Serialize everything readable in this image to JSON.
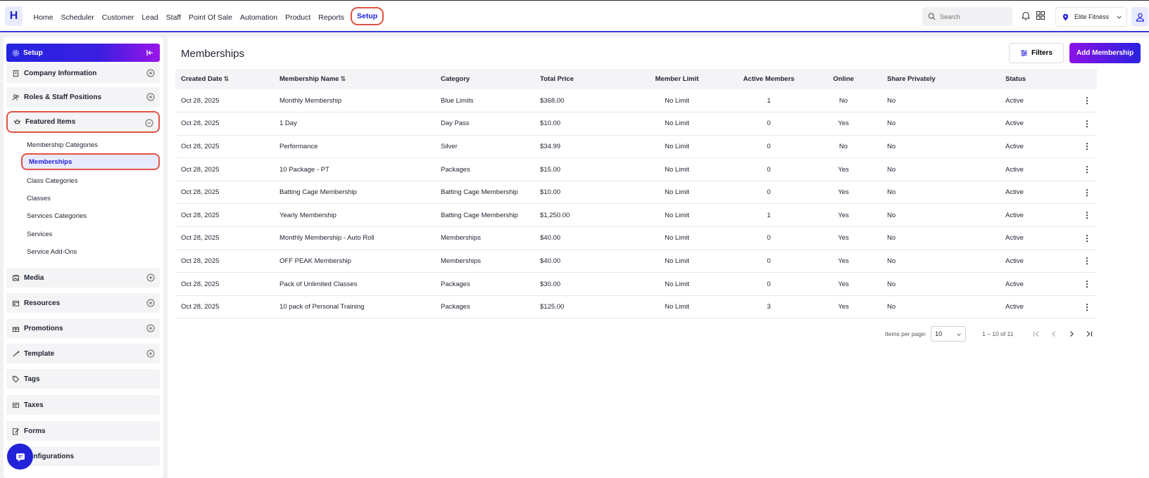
{
  "topbar": {
    "logo": "H",
    "nav": [
      "Home",
      "Scheduler",
      "Customer",
      "Lead",
      "Staff",
      "Point Of Sale",
      "Automation",
      "Product",
      "Reports",
      "Setup"
    ],
    "active_nav": "Setup",
    "search_placeholder": "Search",
    "location": "Elite Fitness"
  },
  "sidebar": {
    "header": "Setup",
    "sections": {
      "company": "Company Information",
      "roles": "Roles & Staff Positions",
      "featured": "Featured Items",
      "media": "Media",
      "resources": "Resources",
      "promotions": "Promotions",
      "template": "Template",
      "tags": "Tags",
      "taxes": "Taxes",
      "forms": "Forms",
      "configurations": "Configurations"
    },
    "featured_items": [
      "Membership Categories",
      "Memberships",
      "Class Categories",
      "Classes",
      "Services Categories",
      "Services",
      "Service Add-Ons"
    ],
    "active_item": "Memberships"
  },
  "main": {
    "title": "Memberships",
    "filters_label": "Filters",
    "add_label": "Add Membership",
    "columns": [
      "Created Date",
      "Membership Name",
      "Category",
      "Total Price",
      "Member Limit",
      "Active Members",
      "Online",
      "Share Privately",
      "Status"
    ],
    "rows": [
      [
        "Oct 28, 2025",
        "Monthly Membership",
        "Blue Limits",
        "$368.00",
        "No Limit",
        "1",
        "No",
        "No",
        "Active"
      ],
      [
        "Oct 28, 2025",
        "1 Day",
        "Day Pass",
        "$10.00",
        "No Limit",
        "0",
        "Yes",
        "No",
        "Active"
      ],
      [
        "Oct 28, 2025",
        "Performance",
        "Silver",
        "$34.99",
        "No Limit",
        "0",
        "No",
        "No",
        "Active"
      ],
      [
        "Oct 28, 2025",
        "10 Package - PT",
        "Packages",
        "$15.00",
        "No Limit",
        "0",
        "Yes",
        "No",
        "Active"
      ],
      [
        "Oct 28, 2025",
        "Batting Cage Membership",
        "Batting Cage Membership",
        "$10.00",
        "No Limit",
        "0",
        "Yes",
        "No",
        "Active"
      ],
      [
        "Oct 28, 2025",
        "Yearly Membership",
        "Batting Cage Membership",
        "$1,250.00",
        "No Limit",
        "1",
        "Yes",
        "No",
        "Active"
      ],
      [
        "Oct 28, 2025",
        "Monthly Membership - Auto Roll",
        "Memberships",
        "$40.00",
        "No Limit",
        "0",
        "Yes",
        "No",
        "Active"
      ],
      [
        "Oct 28, 2025",
        "OFF PEAK Membership",
        "Memberships",
        "$40.00",
        "No Limit",
        "0",
        "Yes",
        "No",
        "Active"
      ],
      [
        "Oct 28, 2025",
        "Pack of Unlimited Classes",
        "Packages",
        "$30.00",
        "No Limit",
        "0",
        "Yes",
        "No",
        "Active"
      ],
      [
        "Oct 28, 2025",
        "10 pack of Personal Training",
        "Packages",
        "$125.00",
        "No Limit",
        "3",
        "Yes",
        "No",
        "Active"
      ]
    ],
    "pagination": {
      "items_per_page_label": "Items per page:",
      "items_per_page": "10",
      "range": "1 – 10 of 11"
    }
  },
  "colors": {
    "accent": "#2323d8",
    "highlight": "#e25346",
    "gradient_end": "#9a14e8"
  }
}
